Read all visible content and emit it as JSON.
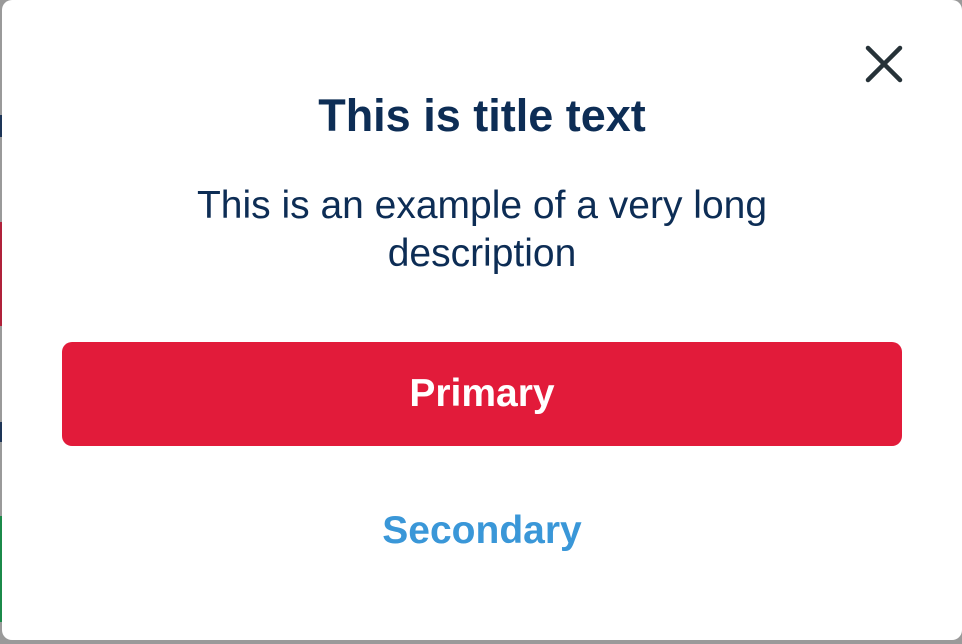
{
  "modal": {
    "title": "This is title text",
    "description": "This is an example of a very long description",
    "close_icon": "close-icon",
    "primary_label": "Primary",
    "secondary_label": "Secondary"
  },
  "colors": {
    "title_text": "#0d2d55",
    "primary_button": "#e21b3a",
    "primary_text": "#ffffff",
    "secondary_text": "#3a97d8",
    "close_icon": "#263238",
    "backdrop": "#9a9a9a"
  }
}
